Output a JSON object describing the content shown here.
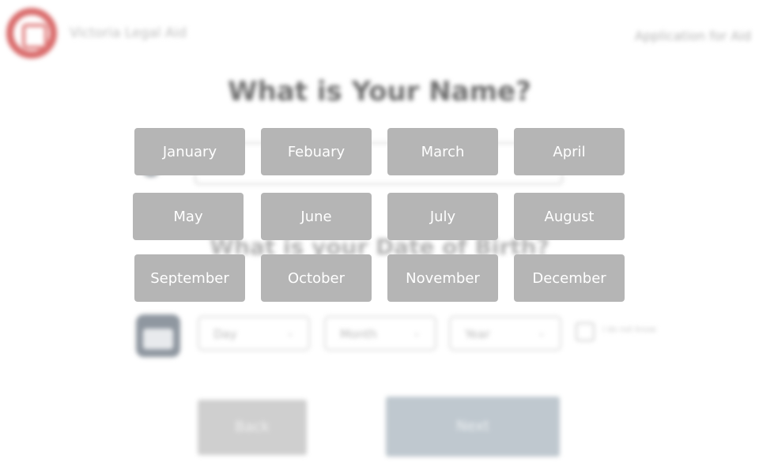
{
  "header": {
    "org_name": "Victoria Legal Aid",
    "app_link": "Application for Aid"
  },
  "form": {
    "name_question": "What is Your Name?",
    "name_placeholder": "",
    "dob_question": "What is your Date of Birth?",
    "day_select": "Day",
    "month_select": "Month",
    "year_select": "Year",
    "unsure_label": "I do not know",
    "back_label": "Back",
    "next_label": "Next"
  },
  "month_picker": {
    "months": [
      "January",
      "Febuary",
      "March",
      "April",
      "May",
      "June",
      "July",
      "August",
      "September",
      "October",
      "November",
      "December"
    ]
  },
  "colors": {
    "month_button_bg": "#b5b5b5",
    "month_button_text": "#ffffff",
    "logo_red": "#d96b6b",
    "next_button_bg": "#bfc8cf"
  },
  "icons": {
    "logo": "logo-icon",
    "person": "person-icon",
    "calendar": "calendar-icon",
    "chevron": "chevron-down-icon"
  }
}
